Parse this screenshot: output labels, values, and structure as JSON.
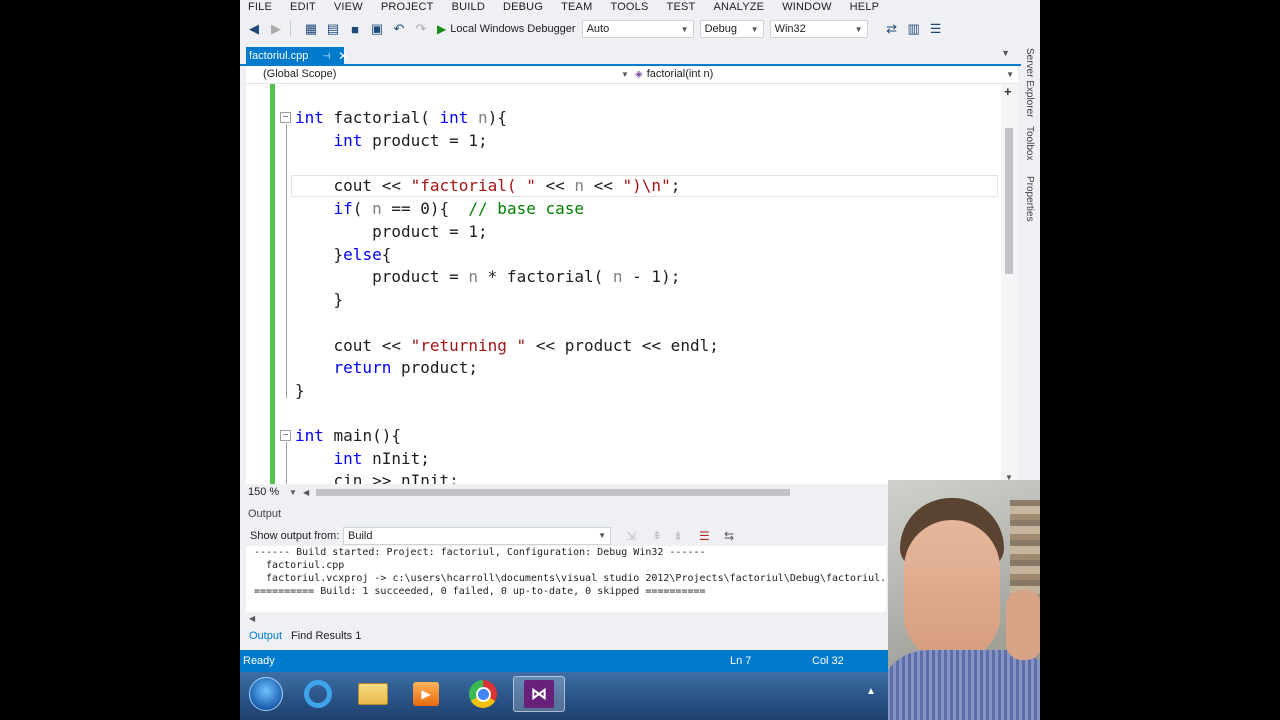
{
  "menu": [
    "FILE",
    "EDIT",
    "VIEW",
    "PROJECT",
    "BUILD",
    "DEBUG",
    "TEAM",
    "TOOLS",
    "TEST",
    "ANALYZE",
    "WINDOW",
    "HELP"
  ],
  "toolbar": {
    "debugger_label": "Local Windows Debugger",
    "debugger_mode": "Auto",
    "configuration": "Debug",
    "platform": "Win32"
  },
  "document_tab": {
    "filename": "factoriul.cpp"
  },
  "scope": {
    "left": "(Global Scope)",
    "right": "factorial(int n)"
  },
  "side_panels": [
    "Server Explorer",
    "Toolbox",
    "Properties"
  ],
  "code_lines": [
    "int factorial( int n){",
    "    int product = 1;",
    "",
    "    cout << \"factorial( \" << n << \")\\n\";",
    "    if( n == 0){  // base case",
    "        product = 1;",
    "    }else{",
    "        product = n * factorial( n - 1);",
    "    }",
    "",
    "    cout << \"returning \" << product << endl;",
    "    return product;",
    "}",
    "",
    "int main(){",
    "    int nInit;",
    "    cin >> nInit;"
  ],
  "zoom": "150 %",
  "output": {
    "title": "Output",
    "show_from_label": "Show output from:",
    "source": "Build",
    "lines": [
      "------ Build started: Project: factoriul, Configuration: Debug Win32 ------",
      "  factoriul.cpp",
      "  factoriul.vcxproj -> c:\\users\\hcarroll\\documents\\visual studio 2012\\Projects\\factoriul\\Debug\\factoriul.exe",
      "========== Build: 1 succeeded, 0 failed, 0 up-to-date, 0 skipped =========="
    ],
    "tabs": [
      "Output",
      "Find Results 1"
    ]
  },
  "status": {
    "ready": "Ready",
    "line": "Ln 7",
    "col": "Col 32"
  },
  "taskbar_apps": [
    "start-orb",
    "internet-explorer",
    "file-explorer",
    "media-player",
    "chrome",
    "visual-studio"
  ],
  "colors": {
    "accent": "#007acc",
    "keyword": "#0000ff",
    "string": "#a31515",
    "comment": "#008000"
  }
}
